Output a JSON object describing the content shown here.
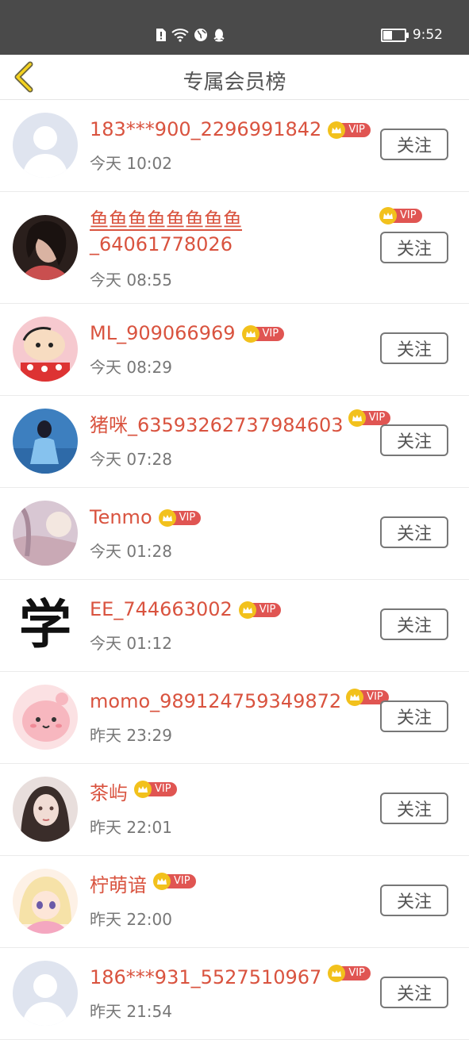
{
  "status_bar": {
    "time": "9:52",
    "battery_level": 0.45
  },
  "header": {
    "title": "专属会员榜"
  },
  "vip_label": "VIP",
  "follow_label": "关注",
  "members": [
    {
      "name": "183***900_2296991842",
      "time": "今天 10:02",
      "avatar": "default"
    },
    {
      "name_line1": "鱼鱼鱼鱼鱼鱼鱼鱼",
      "name_line2": "_64061778026",
      "time": "今天 08:55",
      "avatar": "woman-dark"
    },
    {
      "name": "ML_909066969",
      "time": "今天 08:29",
      "avatar": "cartoon-boy"
    },
    {
      "name": "猪咪_63593262737984603",
      "time": "今天 07:28",
      "avatar": "blue-girl"
    },
    {
      "name": "Tenmo",
      "time": "今天 01:28",
      "avatar": "pastel"
    },
    {
      "name": "EE_744663002",
      "time": "今天 01:12",
      "avatar": "xue-char"
    },
    {
      "name": "momo_989124759349872",
      "time": "昨天 23:29",
      "avatar": "pink-cartoon"
    },
    {
      "name": "茶屿",
      "time": "昨天 22:01",
      "avatar": "drawn-girl"
    },
    {
      "name": "柠萌谙",
      "time": "昨天 22:00",
      "avatar": "anime-girl"
    },
    {
      "name": "186***931_5527510967",
      "time": "昨天 21:54",
      "avatar": "default"
    }
  ],
  "avatar_glyph": "学"
}
